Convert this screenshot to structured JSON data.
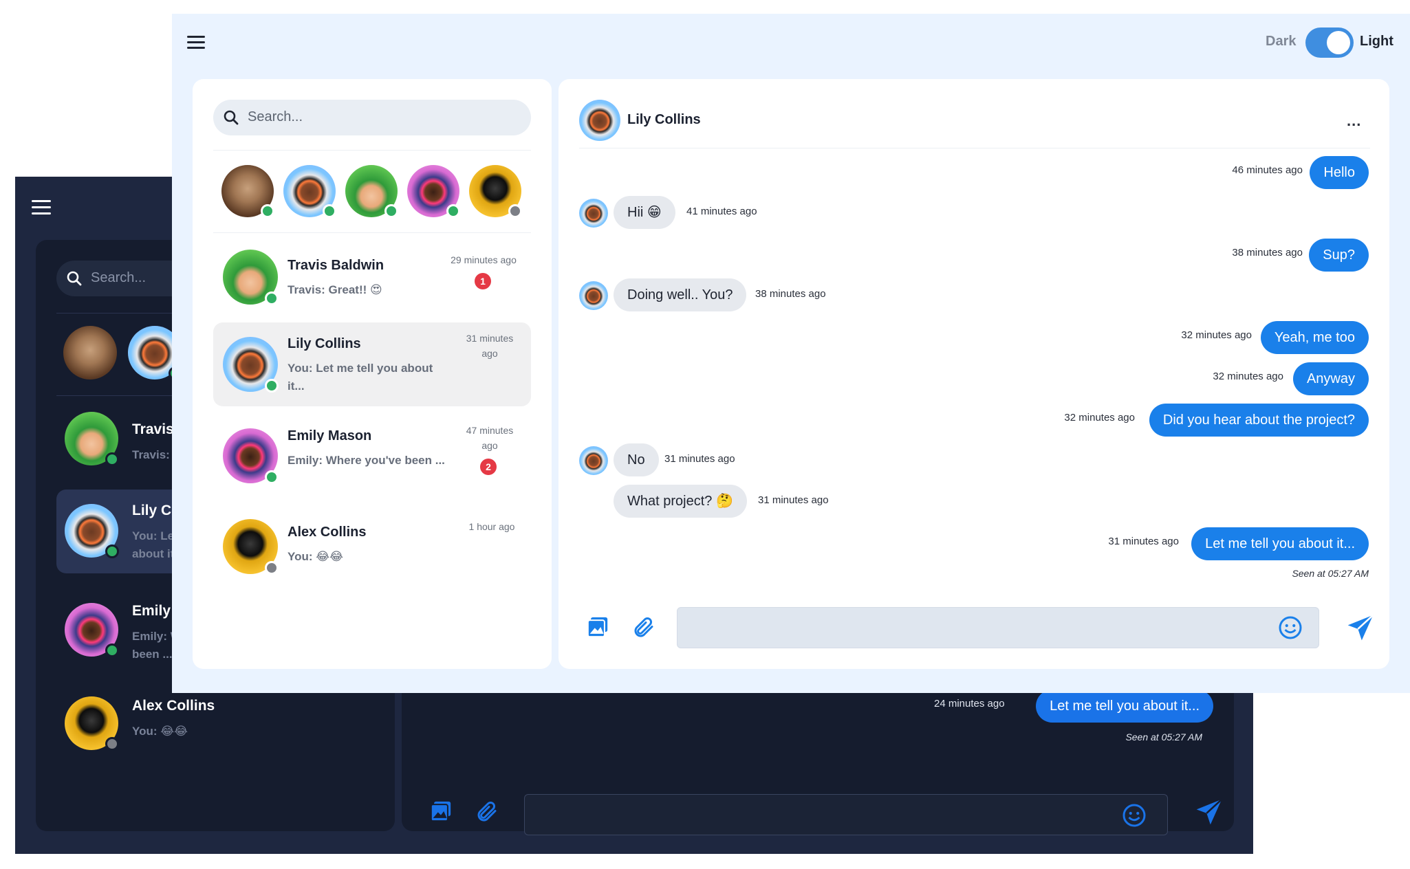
{
  "dark_window": {
    "search_placeholder": "Search...",
    "conversations": [
      {
        "name": "Travis Baldwin",
        "preview": "Travis: Great!! 😍"
      },
      {
        "name": "Lily Collins",
        "preview": "You: Let me tell you about it..."
      },
      {
        "name": "Emily Mason",
        "preview": "Emily: Where you've been ..."
      },
      {
        "name": "Alex Collins",
        "preview": "You: 😂😂"
      }
    ],
    "last_message": {
      "time": "24 minutes ago",
      "text": "Let me tell you about it..."
    },
    "seen": "Seen at 05:27 AM"
  },
  "header": {
    "dark_label": "Dark",
    "light_label": "Light",
    "theme_toggle_on": true
  },
  "sidebar": {
    "search_placeholder": "Search...",
    "conversations": [
      {
        "name": "Travis Baldwin",
        "preview": "Travis: Great!! 😍",
        "time": "29 minutes ago",
        "unread": "1",
        "status": "online"
      },
      {
        "name": "Lily Collins",
        "preview": "You: Let me tell you about it...",
        "time": "31 minutes ago",
        "unread": "",
        "status": "online",
        "selected": true
      },
      {
        "name": "Emily Mason",
        "preview": "Emily: Where you've been ...",
        "time": "47 minutes ago",
        "unread": "2",
        "status": "online"
      },
      {
        "name": "Alex Collins",
        "preview": "You: 😂😂",
        "time": "1 hour ago",
        "unread": "",
        "status": "offline"
      }
    ]
  },
  "chat": {
    "contact_name": "Lily Collins",
    "more_label": "...",
    "messages": [
      {
        "dir": "out",
        "text": "Hello",
        "time": "46 minutes ago"
      },
      {
        "dir": "in",
        "text": "Hii 😁",
        "time": "41 minutes ago"
      },
      {
        "dir": "out",
        "text": "Sup?",
        "time": "38 minutes ago"
      },
      {
        "dir": "in",
        "text": "Doing well.. You?",
        "time": "38 minutes ago"
      },
      {
        "dir": "out",
        "text": "Yeah, me too",
        "time": "32 minutes ago"
      },
      {
        "dir": "out",
        "text": "Anyway",
        "time": "32 minutes ago"
      },
      {
        "dir": "out",
        "text": "Did you hear about the project?",
        "time": "32 minutes ago"
      },
      {
        "dir": "in",
        "text": "No",
        "time": "31 minutes ago"
      },
      {
        "dir": "in",
        "text": "What project? 🤔",
        "time": "31 minutes ago"
      },
      {
        "dir": "out",
        "text": "Let me tell you about it...",
        "time": "31 minutes ago"
      }
    ],
    "seen": "Seen at 05:27 AM",
    "input_value": "",
    "accent_color": "#1a80ea"
  },
  "icons": [
    "menu-icon",
    "search-icon",
    "image-icon",
    "paperclip-icon",
    "emoji-icon",
    "send-icon",
    "more-icon"
  ]
}
